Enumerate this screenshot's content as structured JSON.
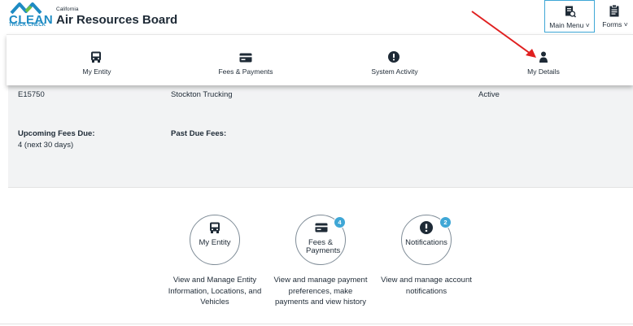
{
  "header": {
    "logo_clean": "CLEAN",
    "logo_subtitle": "TRUCK CHECK",
    "org_supertitle": "California",
    "org_title": "Air Resources Board",
    "main_menu_label": "Main Menu",
    "forms_label": "Forms"
  },
  "menu": {
    "items": [
      {
        "label": "My Entity",
        "icon": "truck-icon"
      },
      {
        "label": "Fees & Payments",
        "icon": "credit-card-icon"
      },
      {
        "label": "System Activity",
        "icon": "alert-circle-icon"
      },
      {
        "label": "My Details",
        "icon": "person-icon"
      }
    ]
  },
  "summary": {
    "entity_id": "E15750",
    "entity_name": "Stockton Trucking",
    "status": "Active",
    "upcoming_fees_label": "Upcoming Fees Due:",
    "upcoming_fees_value": "4 (next 30 days)",
    "past_due_label": "Past Due Fees:"
  },
  "cards": [
    {
      "title": "My Entity",
      "description": "View and Manage Entity Information, Locations, and Vehicles",
      "icon": "truck-icon"
    },
    {
      "title": "Fees & Payments",
      "badge": "4",
      "description": "View and manage payment preferences, make payments and view history",
      "icon": "credit-card-icon"
    },
    {
      "title": "Notifications",
      "badge": "2",
      "description": "View and manage account notifications",
      "icon": "alert-circle-icon"
    }
  ],
  "colors": {
    "brand_blue": "#1e8bc3",
    "brand_green": "#6cc04a",
    "accent": "#3fa7d6",
    "arrow": "#e02020",
    "panel_bg": "#f2f3f4"
  }
}
